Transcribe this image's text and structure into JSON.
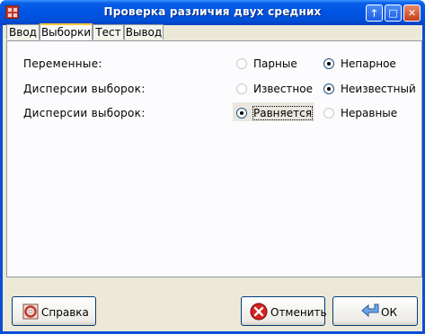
{
  "window": {
    "title": "Проверка различия двух средних"
  },
  "title_buttons": {
    "minimize": "🡑",
    "maximize": "□",
    "close": "✕"
  },
  "tabs": [
    {
      "label": "Ввод",
      "active": false
    },
    {
      "label": "Выборки",
      "active": true
    },
    {
      "label": "Тест",
      "active": false
    },
    {
      "label": "Вывод",
      "active": false
    }
  ],
  "rows": [
    {
      "label": "Переменные:",
      "options": [
        {
          "label": "Парные",
          "selected": false
        },
        {
          "label": "Непарное",
          "selected": true
        }
      ]
    },
    {
      "label": "Дисперсии выборок:",
      "options": [
        {
          "label": "Известное",
          "selected": false
        },
        {
          "label": "Неизвестный",
          "selected": true
        }
      ]
    },
    {
      "label": "Дисперсии выборок:",
      "options": [
        {
          "label": "Равняется",
          "selected": true
        },
        {
          "label": "Неравные",
          "selected": false
        }
      ]
    }
  ],
  "buttons": {
    "help": "Справка",
    "cancel": "Отменить",
    "ok": "ОК"
  },
  "colors": {
    "titlebar": "#0054e3",
    "window_bg": "#ece9d8",
    "tab_accent": "#ffc83c"
  },
  "icons": {
    "help": "lifebuoy-icon",
    "cancel": "cancel-x-icon",
    "ok": "return-arrow-icon"
  }
}
